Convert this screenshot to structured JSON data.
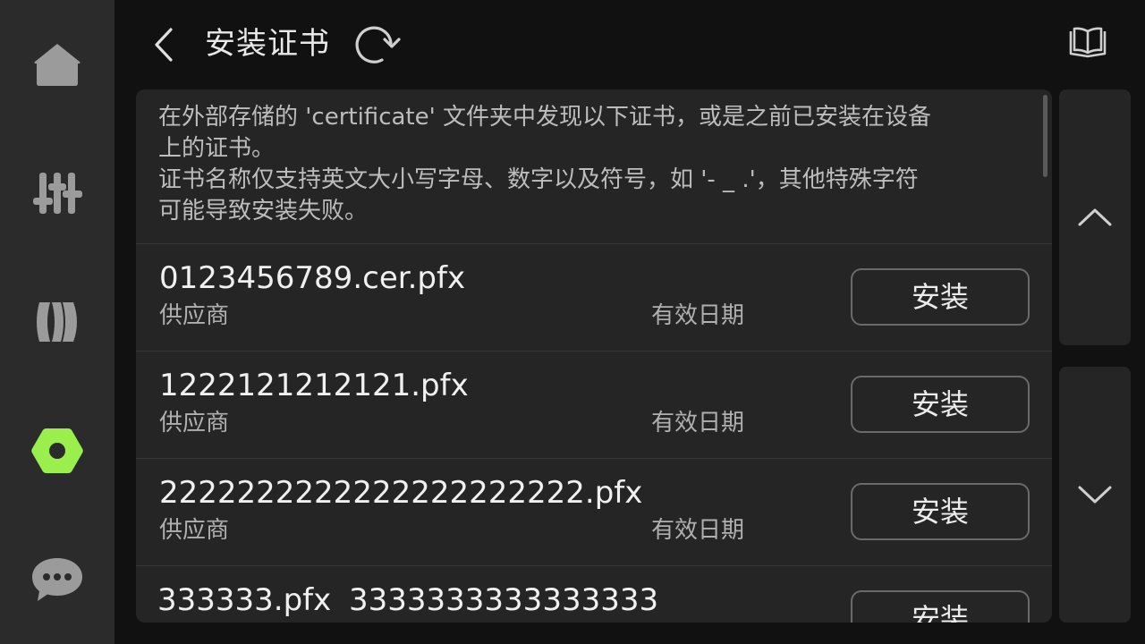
{
  "sidebar": {
    "items": [
      {
        "icon": "home-icon",
        "active": false
      },
      {
        "icon": "sliders-icon",
        "active": false
      },
      {
        "icon": "tracks-icon",
        "active": false
      },
      {
        "icon": "settings-hex-icon",
        "active": true
      },
      {
        "icon": "chat-bubble-icon",
        "active": false
      }
    ],
    "accent": "#9aef4c",
    "icon_color": "#9b9b9b"
  },
  "header": {
    "title": "安装证书",
    "back_icon": "chevron-left-icon",
    "refresh_icon": "refresh-icon",
    "manual_icon": "book-icon"
  },
  "description": {
    "line1": "在外部存储的 'certificate' 文件夹中发现以下证书，或是之前已安装在设备",
    "line2": "上的证书。",
    "line3": "证书名称仅支持英文大小写字母、数字以及符号，如 '- _ .'，其他特殊字符",
    "line4": "可能导致安装失败。"
  },
  "certificates": [
    {
      "name": "0123456789.cer.pfx",
      "vendor": "供应商",
      "validity": "有效日期",
      "install_label": "安装"
    },
    {
      "name": "1222121212121.pfx",
      "vendor": "供应商",
      "validity": "有效日期",
      "install_label": "安装"
    },
    {
      "name": "2222222222222222222222.pfx",
      "vendor": "供应商",
      "validity": "有效日期",
      "install_label": "安装"
    },
    {
      "name": "333333.pfx",
      "name_extra": "3333333333333333",
      "install_label": "安装"
    }
  ],
  "scroll": {
    "up_icon": "chevron-up-icon",
    "down_icon": "chevron-down-icon"
  }
}
